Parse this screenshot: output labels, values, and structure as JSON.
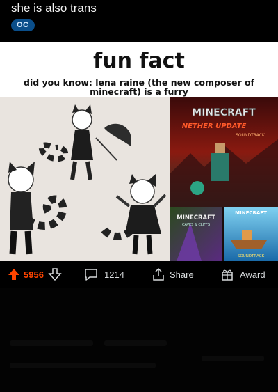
{
  "post": {
    "title": "she is also trans",
    "flair": "OC"
  },
  "meme": {
    "title": "fun fact",
    "caption": "did you know: lena raine (the new composer of minecraft) is a furry",
    "album_logo_main": "MINECRAFT",
    "album_subtitle_main": "NETHER UPDATE",
    "album_tag_main": "SOUNDTRACK",
    "album_logo_left": "MINECRAFT",
    "album_subtitle_left": "CAVES & CLIFFS",
    "album_logo_right": "MINECRAFT",
    "album_tag_right": "SOUNDTRACK"
  },
  "actions": {
    "upvote_count": "5956",
    "comment_count": "1214",
    "share_label": "Share",
    "award_label": "Award"
  },
  "colors": {
    "upvote": "#ff4500",
    "flair_bg": "#0a4e8a"
  },
  "icons": [
    "upvote-icon",
    "downvote-icon",
    "comment-icon",
    "share-icon",
    "award-icon"
  ]
}
